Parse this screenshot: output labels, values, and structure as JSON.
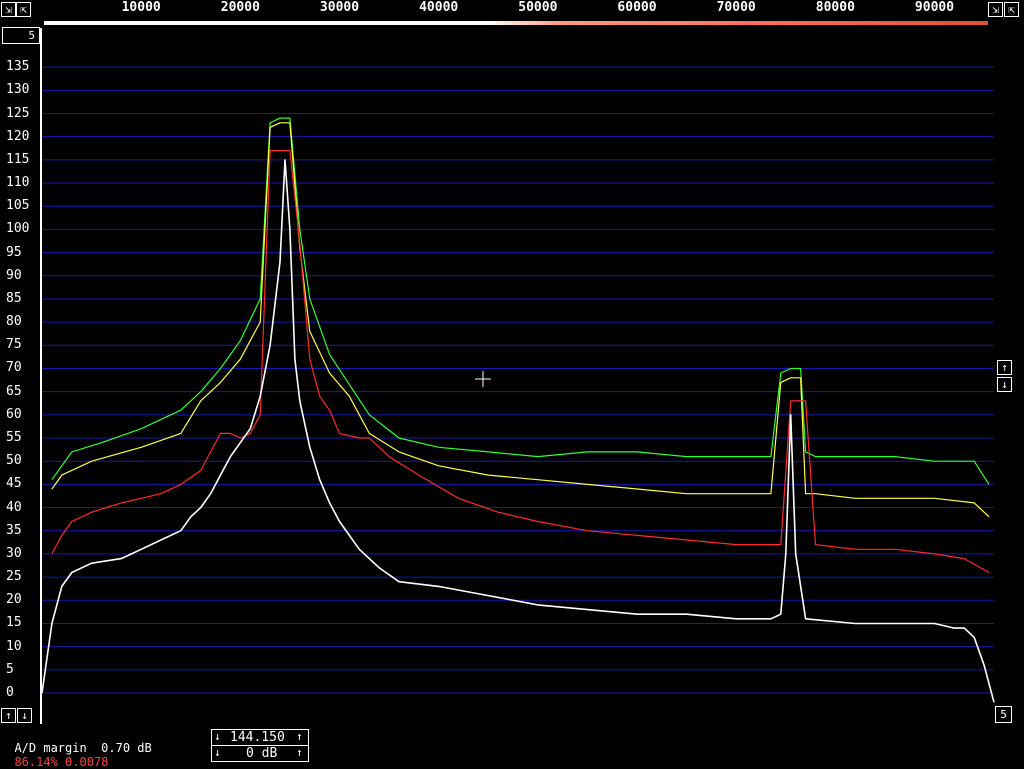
{
  "top_scale": {
    "ticks": [
      "10000",
      "20000",
      "30000",
      "40000",
      "50000",
      "60000",
      "70000",
      "80000",
      "90000"
    ],
    "left_buttons": [
      "⇲",
      "⇱"
    ],
    "right_buttons": [
      "⇲",
      "⇱"
    ]
  },
  "corner_box": "5",
  "side_buttons": {
    "up": "↑",
    "down": "↓"
  },
  "bottom_left_buttons": [
    "↑",
    "↓"
  ],
  "bottom_right_box": "5",
  "status": {
    "ad_margin_label": "A/D margin",
    "ad_margin_value": "0.70 dB",
    "percent": "86.14%",
    "ratio": "0.0078"
  },
  "frequency_box": {
    "value": "144.150",
    "level": "0 dB",
    "up": "↑",
    "down": "↓"
  },
  "colors": {
    "grid": "#1818b0",
    "white": "#ffffff",
    "red": "#ff2a2a",
    "yellow": "#ffff40",
    "green": "#30ff30",
    "status_red": "#ff4040"
  },
  "chart_data": {
    "type": "line",
    "xlim": [
      0,
      96000
    ],
    "ylim": [
      -3,
      137
    ],
    "yticks": [
      0,
      5,
      10,
      15,
      20,
      25,
      30,
      35,
      40,
      45,
      50,
      55,
      60,
      65,
      70,
      75,
      80,
      85,
      90,
      95,
      100,
      105,
      110,
      115,
      120,
      125,
      130,
      135
    ],
    "grid": true,
    "series": [
      {
        "color": "green",
        "x": [
          1000,
          3000,
          6000,
          10000,
          14000,
          16000,
          18000,
          20000,
          22000,
          23000,
          24000,
          25000,
          26000,
          27000,
          29000,
          33000,
          36000,
          40000,
          45000,
          50000,
          55000,
          60000,
          65000,
          70000,
          73500,
          74500,
          75500,
          76500,
          77000,
          78000,
          82000,
          86000,
          90000,
          94000,
          95500
        ],
        "y": [
          46,
          52,
          54,
          57,
          61,
          65,
          70,
          76,
          85,
          123,
          124,
          124,
          100,
          85,
          73,
          60,
          55,
          53,
          52,
          51,
          52,
          52,
          51,
          51,
          51,
          69,
          70,
          70,
          52,
          51,
          51,
          51,
          50,
          50,
          45
        ]
      },
      {
        "color": "yellow",
        "x": [
          1000,
          2000,
          5000,
          10000,
          14000,
          16000,
          18000,
          20000,
          22000,
          23000,
          24000,
          25000,
          26000,
          27000,
          29000,
          31000,
          33000,
          36000,
          40000,
          45000,
          50000,
          55000,
          60000,
          65000,
          70000,
          73500,
          74500,
          75500,
          76500,
          77000,
          78000,
          82000,
          86000,
          90000,
          94000,
          95500
        ],
        "y": [
          44,
          47,
          50,
          53,
          56,
          63,
          67,
          72,
          80,
          122,
          123,
          123,
          96,
          78,
          69,
          64,
          56,
          52,
          49,
          47,
          46,
          45,
          44,
          43,
          43,
          43,
          67,
          68,
          68,
          43,
          43,
          42,
          42,
          42,
          41,
          38
        ]
      },
      {
        "color": "red",
        "x": [
          1000,
          2000,
          3000,
          5000,
          8000,
          12000,
          14000,
          16000,
          18000,
          19000,
          20000,
          21000,
          22000,
          23000,
          24000,
          25000,
          26000,
          27000,
          28000,
          29000,
          30000,
          32000,
          33000,
          35000,
          38000,
          42000,
          46000,
          50000,
          55000,
          60000,
          65000,
          70000,
          73500,
          74500,
          75500,
          76500,
          77000,
          78000,
          82000,
          86000,
          90000,
          93000,
          95500
        ],
        "y": [
          30,
          34,
          37,
          39,
          41,
          43,
          45,
          48,
          56,
          56,
          55,
          56,
          60,
          117,
          117,
          117,
          97,
          72,
          64,
          61,
          56,
          55,
          55,
          51,
          47,
          42,
          39,
          37,
          35,
          34,
          33,
          32,
          32,
          32,
          63,
          63,
          63,
          32,
          31,
          31,
          30,
          29,
          26
        ]
      },
      {
        "color": "white",
        "x": [
          0,
          1000,
          2000,
          3000,
          5000,
          8000,
          10000,
          12000,
          14000,
          15000,
          16000,
          17000,
          18000,
          19000,
          20000,
          21000,
          22000,
          23000,
          24000,
          24500,
          25000,
          25500,
          26000,
          27000,
          28000,
          29000,
          30000,
          32000,
          34000,
          36000,
          40000,
          45000,
          50000,
          55000,
          60000,
          65000,
          70000,
          73500,
          74500,
          75000,
          75500,
          76000,
          77000,
          82000,
          86000,
          90000,
          92000,
          93000,
          94000,
          95000,
          96000
        ],
        "y": [
          0,
          15,
          23,
          26,
          28,
          29,
          31,
          33,
          35,
          38,
          40,
          43,
          47,
          51,
          54,
          57,
          64,
          75,
          93,
          115,
          100,
          72,
          63,
          53,
          46,
          41,
          37,
          31,
          27,
          24,
          23,
          21,
          19,
          18,
          17,
          17,
          16,
          16,
          17,
          30,
          60,
          30,
          16,
          15,
          15,
          15,
          14,
          14,
          12,
          6,
          -2
        ]
      }
    ]
  }
}
